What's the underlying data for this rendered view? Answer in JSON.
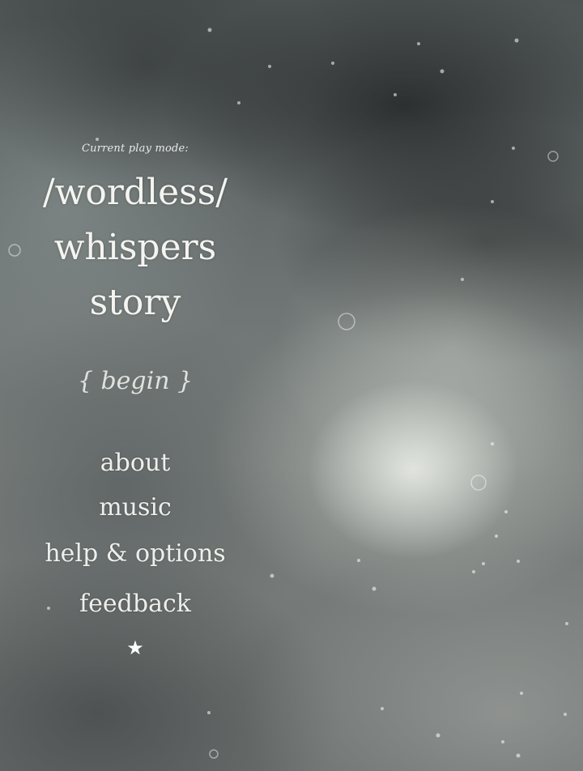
{
  "menu": {
    "mode_label": "Current play mode:",
    "title_line1": "/wordless/",
    "title_line2": "whispers",
    "title_line3": "story",
    "begin": "{ begin }",
    "about": "about",
    "music": "music",
    "help_options": "help & options",
    "feedback": "feedback",
    "star": "★"
  },
  "background": {
    "description_icon": "stormy-clouds-image"
  }
}
